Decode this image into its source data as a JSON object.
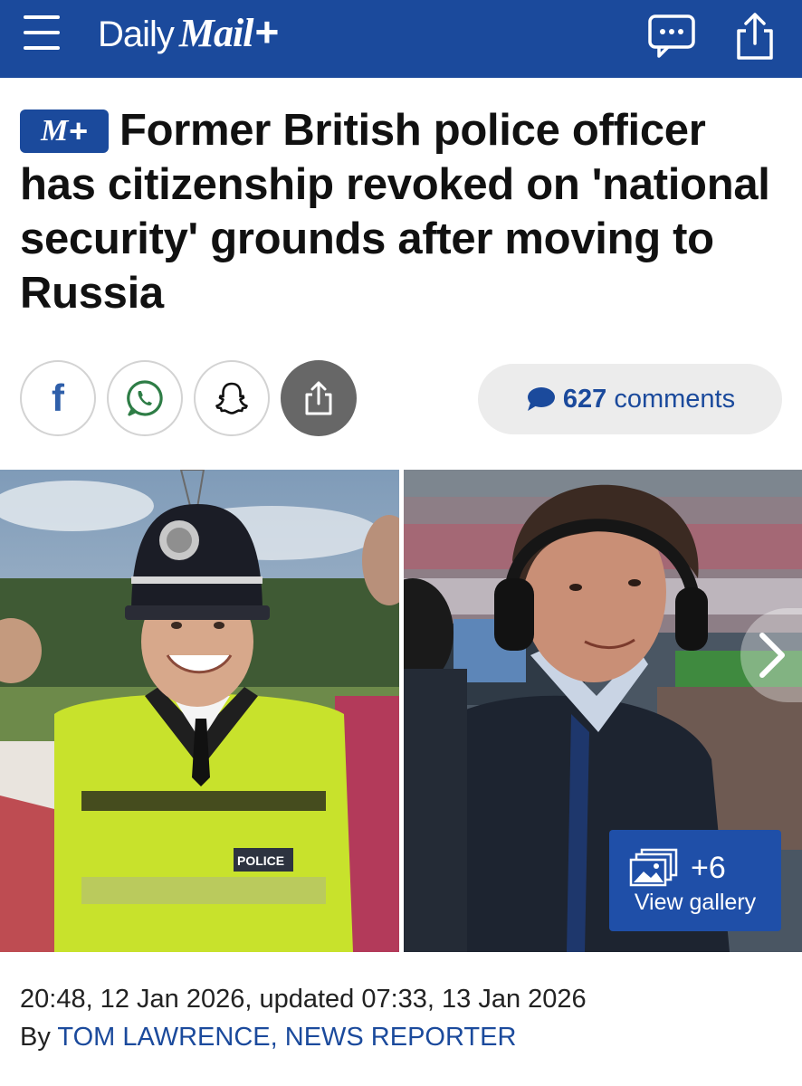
{
  "header": {
    "logo_daily": "Daily",
    "logo_mail": "Mail",
    "logo_plus": "+",
    "brand_color": "#1b4a9c",
    "menu_icon": "hamburger-menu-icon",
    "chat_icon": "chat-bubble-icon",
    "share_icon": "share-icon"
  },
  "article": {
    "badge_m": "M",
    "badge_plus": "+",
    "headline": "Former British police officer has citizenship revoked on 'national security' grounds after moving to Russia"
  },
  "share": {
    "facebook_glyph": "f",
    "icons": [
      "facebook-icon",
      "whatsapp-icon",
      "snapchat-icon",
      "share-icon"
    ],
    "comments_count": "627",
    "comments_label": "comments"
  },
  "gallery": {
    "extra_count": "+6",
    "view_label": "View gallery",
    "images": [
      {
        "description_icon": "photo-police-officer"
      },
      {
        "description_icon": "photo-stadium-commentator"
      }
    ],
    "left_photo": {
      "helmet_text": "",
      "jacket_text": "POLICE"
    }
  },
  "meta": {
    "timestamp": "20:48, 12 Jan 2026, updated 07:33, 13 Jan 2026",
    "by_prefix": "By",
    "author": "TOM LAWRENCE, NEWS REPORTER"
  }
}
